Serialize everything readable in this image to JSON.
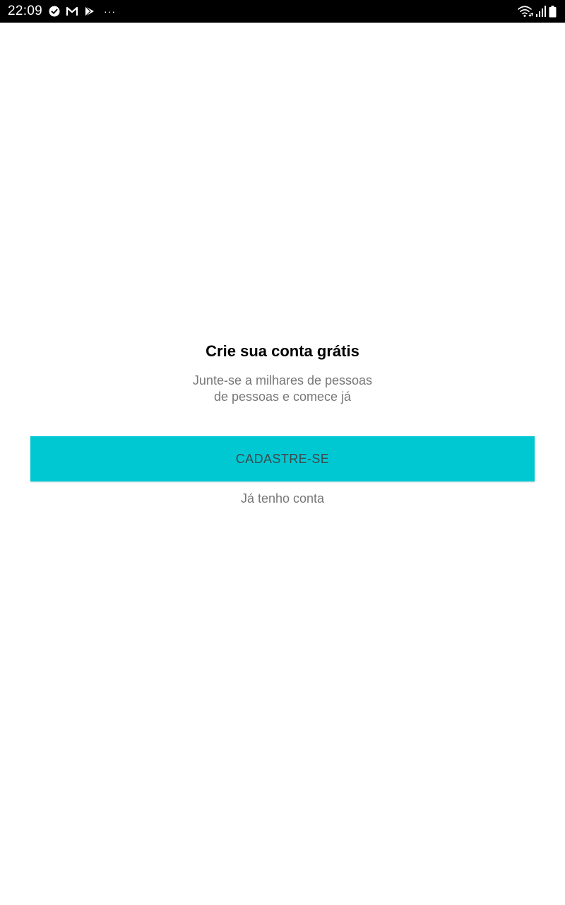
{
  "status_bar": {
    "time": "22:09",
    "left_icons": [
      "check-circle-icon",
      "gmail-icon",
      "play-store-icon",
      "more-notifications-icon"
    ],
    "more_glyph": "···",
    "right_icons": [
      "wifi-icon",
      "signal-icon",
      "battery-icon"
    ]
  },
  "main": {
    "title": "Crie sua conta grátis",
    "subtitle_line1": "Junte-se a milhares de pessoas",
    "subtitle_line2": "de pessoas e comece já",
    "signup_label": "CADASTRE-SE",
    "login_label": "Já tenho conta"
  },
  "colors": {
    "accent": "#00c8d3",
    "status_bar": "#000000",
    "subtitle_text": "#777777",
    "button_text": "#3b4a4c"
  }
}
